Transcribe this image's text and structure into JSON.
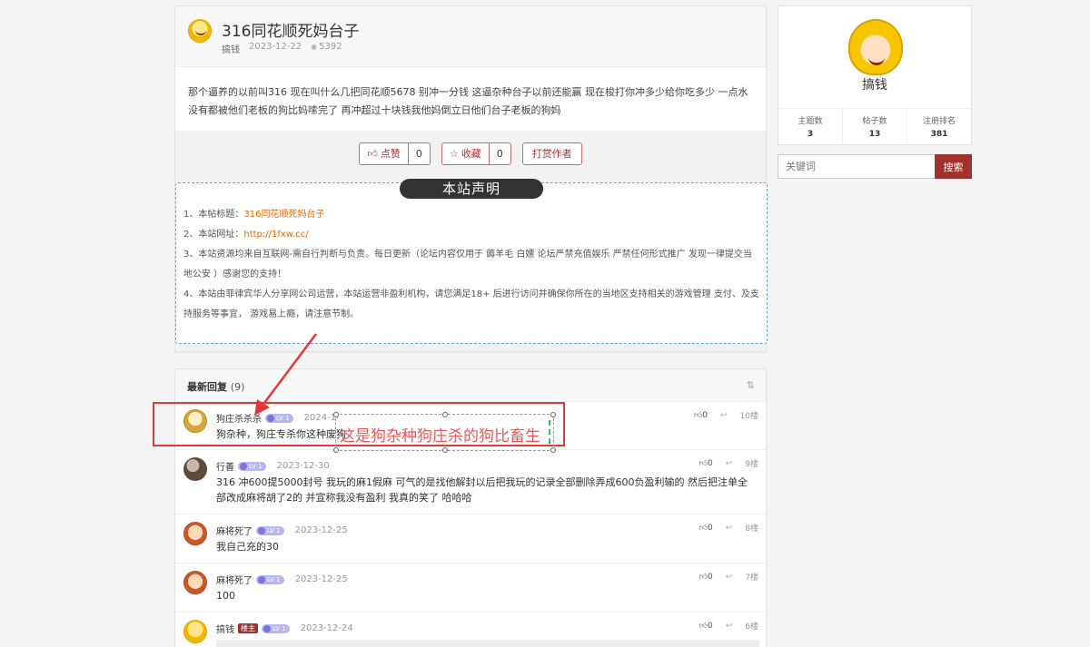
{
  "post": {
    "title": "316同花顺死妈台子",
    "author": "搞钱",
    "date": "2023-12-22",
    "views": "5392",
    "body": "那个逼养的以前叫316 现在叫什么几把同花顺5678 别冲一分钱 这逼杂种台子以前还能赢 现在梭打你冲多少给你吃多少 一点水没有都被他们老板的狗比妈嗦完了 再冲超过十块钱我他妈倒立日他们台子老板的狗妈"
  },
  "actions": {
    "like_label": "点赞",
    "like_count": "0",
    "fav_label": "收藏",
    "fav_count": "0",
    "tip_label": "打赏作者"
  },
  "notice": {
    "badge": "本站声明",
    "line1_prefix": "1、本帖标题：",
    "line1_value": "316同花顺死妈台子",
    "line2_prefix": "2、本站网址：",
    "line2_value": "http://1fxw.cc/",
    "line3": "3、本站资源均来自互联网-需自行判断与负责。每日更新（论坛内容仅用于 薅羊毛 白嫖 论坛严禁充值娱乐 严禁任何形式推广 发现一律提交当地公安 ）感谢您的支持！",
    "line4": "4、本站由菲律宾华人分享网公司运营，本站运营非盈利机构，请您满足18+ 后进行访问并确保你所在的当地区支持相关的游戏管理 支付、及支持服务等事宜， 游戏易上瘾，请注意节制。"
  },
  "replies": {
    "title": "最新回复",
    "count": "(9)",
    "items": [
      {
        "user": "狗庄杀杀杀",
        "level": "LV 1",
        "date": "2024-1-",
        "text": "狗杂种，狗庄专杀你这种废狗",
        "likes": "0",
        "floor": "10楼"
      },
      {
        "user": "行善",
        "level": "LV 1",
        "date": "2023-12-30",
        "text": "316  冲600提5000封号  我玩的麻1假麻  可气的是找他解封以后把我玩的记录全部删除弄成600负盈利输的  然后把注单全部改成麻将胡了2的  并宣称我没有盈利  我真的笑了  哈哈哈",
        "likes": "0",
        "floor": "9楼"
      },
      {
        "user": "麻将死了",
        "level": "LV 1",
        "date": "2023-12-25",
        "text": "我自己充的30",
        "likes": "0",
        "floor": "8楼"
      },
      {
        "user": "麻将死了",
        "level": "LV 1",
        "date": "2023-12-25",
        "text": "100",
        "likes": "0",
        "floor": "7楼"
      },
      {
        "user": "搞钱",
        "owner": "楼主",
        "level": "LV 1",
        "date": "2023-12-24",
        "text": "",
        "likes": "0",
        "floor": "6楼"
      }
    ]
  },
  "annotation": {
    "caption": "这是狗杂种狗庄杀的狗比畜生"
  },
  "sidebar": {
    "name": "搞钱",
    "stats": [
      {
        "label": "主题数",
        "value": "3"
      },
      {
        "label": "帖子数",
        "value": "13"
      },
      {
        "label": "注册排名",
        "value": "381"
      }
    ],
    "search_placeholder": "关键词",
    "search_button": "搜索"
  },
  "colors": {
    "accent": "#a2302d",
    "link": "#e56a00",
    "annotation": "#e23a3a"
  }
}
